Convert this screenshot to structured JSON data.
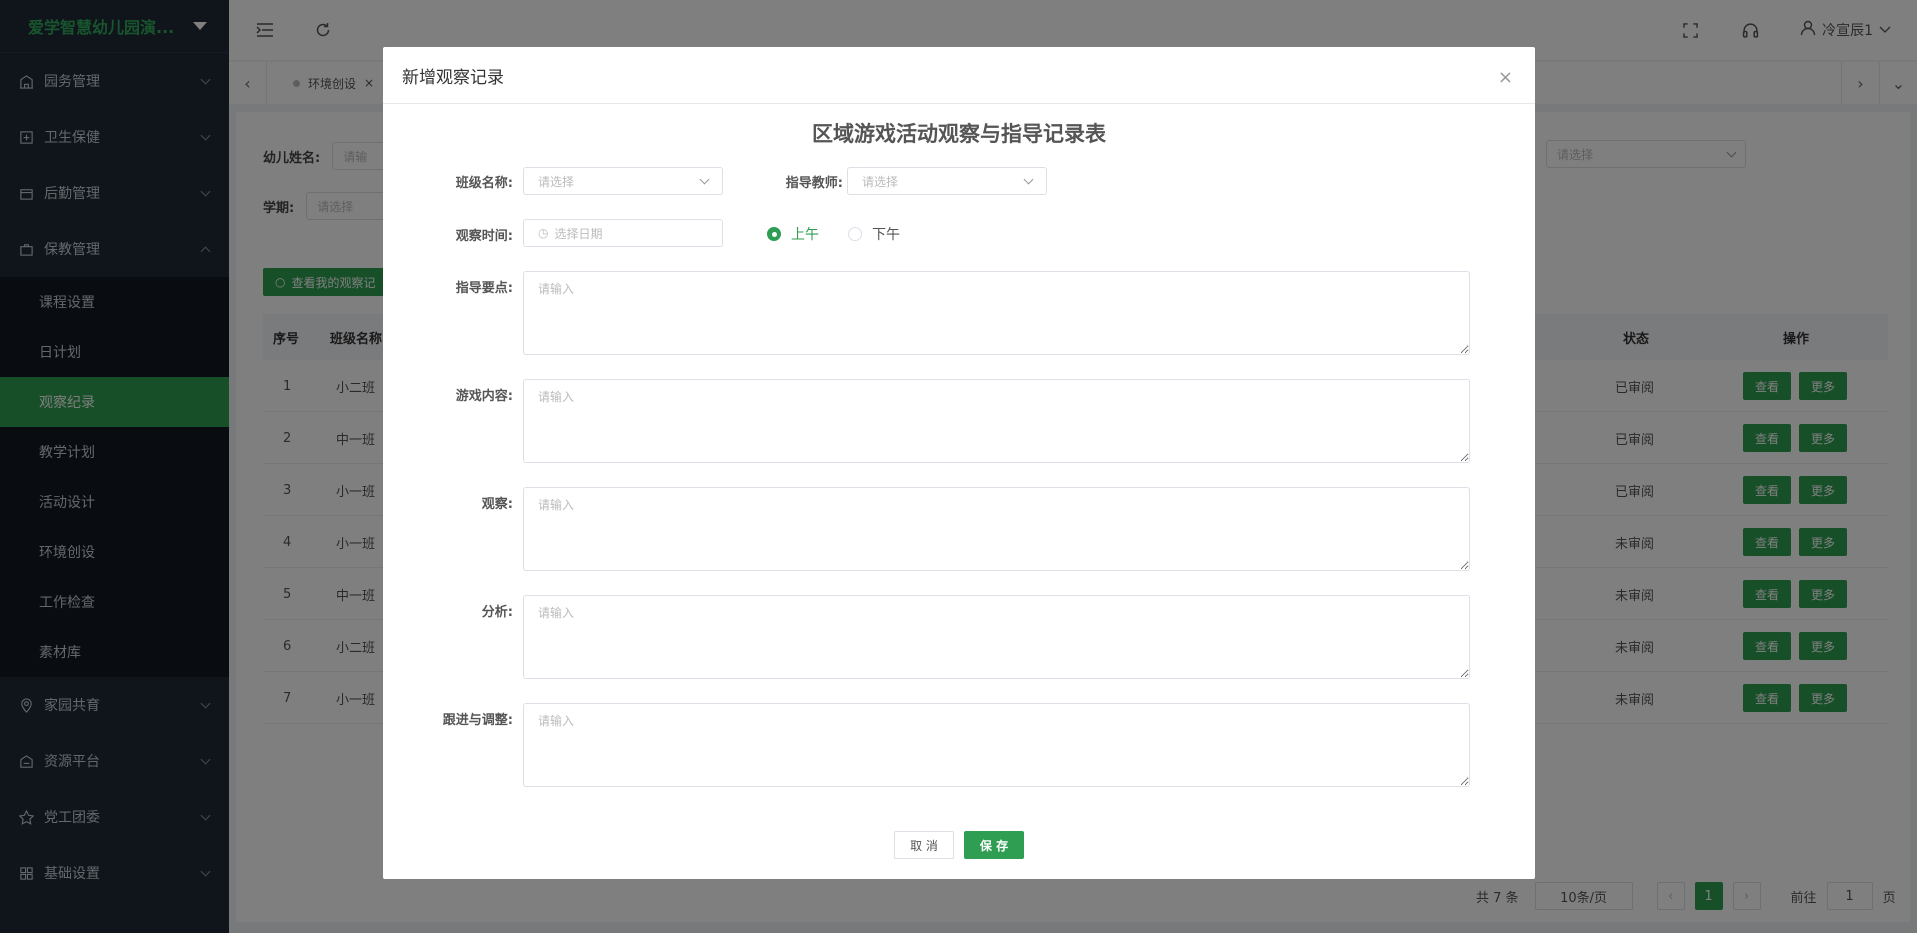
{
  "app": {
    "title": "爱学智慧幼儿园演..."
  },
  "sidebar": {
    "groups": [
      {
        "label": "园务管理",
        "icon": "building-icon"
      },
      {
        "label": "卫生保健",
        "icon": "medical-icon"
      },
      {
        "label": "后勤管理",
        "icon": "box-icon"
      },
      {
        "label": "保教管理",
        "icon": "briefcase-icon"
      }
    ],
    "sub_items": [
      "课程设置",
      "日计划",
      "观察纪录",
      "教学计划",
      "活动设计",
      "环境创设",
      "工作检查",
      "素材库"
    ],
    "groups_after": [
      {
        "label": "家园共育",
        "icon": "heart-location-icon"
      },
      {
        "label": "资源平台",
        "icon": "resource-icon"
      },
      {
        "label": "党工团委",
        "icon": "star-icon"
      },
      {
        "label": "基础设置",
        "icon": "grid-icon"
      }
    ]
  },
  "topbar": {
    "user": "冷宣辰1"
  },
  "tabs": {
    "tab1": "环境创设"
  },
  "filters": {
    "child_name_label": "幼儿姓名:",
    "child_name_placeholder": "请输",
    "term_label": "学期:",
    "term_placeholder": "请选择",
    "right_select_placeholder": "请选择",
    "my_records_btn": "查看我的观察记"
  },
  "table": {
    "headers": {
      "no": "序号",
      "class": "班级名称",
      "status": "状态",
      "ops": "操作"
    },
    "rows": [
      {
        "no": "1",
        "class": "小二班",
        "status": "已审阅"
      },
      {
        "no": "2",
        "class": "中一班",
        "status": "已审阅"
      },
      {
        "no": "3",
        "class": "小一班",
        "status": "已审阅"
      },
      {
        "no": "4",
        "class": "小一班",
        "status": "未审阅"
      },
      {
        "no": "5",
        "class": "中一班",
        "status": "未审阅"
      },
      {
        "no": "6",
        "class": "小二班",
        "status": "未审阅"
      },
      {
        "no": "7",
        "class": "小一班",
        "status": "未审阅"
      }
    ],
    "view_label": "查看",
    "more_label": "更多"
  },
  "pager": {
    "total": "共 7 条",
    "page_size": "10条/页",
    "current": "1",
    "goto_label": "前往",
    "goto_value": "1",
    "page_unit": "页"
  },
  "modal": {
    "header": "新增观察记录",
    "title": "区域游戏活动观察与指导记录表",
    "class_label": "班级名称:",
    "class_placeholder": "请选择",
    "teacher_label": "指导教师:",
    "teacher_placeholder": "请选择",
    "time_label": "观察时间:",
    "date_placeholder": "选择日期",
    "am": "上午",
    "pm": "下午",
    "fields": [
      {
        "label": "指导要点:",
        "placeholder": "请输入"
      },
      {
        "label": "游戏内容:",
        "placeholder": "请输入"
      },
      {
        "label": "观察:",
        "placeholder": "请输入"
      },
      {
        "label": "分析:",
        "placeholder": "请输入"
      },
      {
        "label": "跟进与调整:",
        "placeholder": "请输入"
      }
    ],
    "cancel": "取 消",
    "save": "保 存"
  },
  "colors": {
    "brand": "#2f9e52",
    "sidebar_bg": "#1e2a36"
  }
}
